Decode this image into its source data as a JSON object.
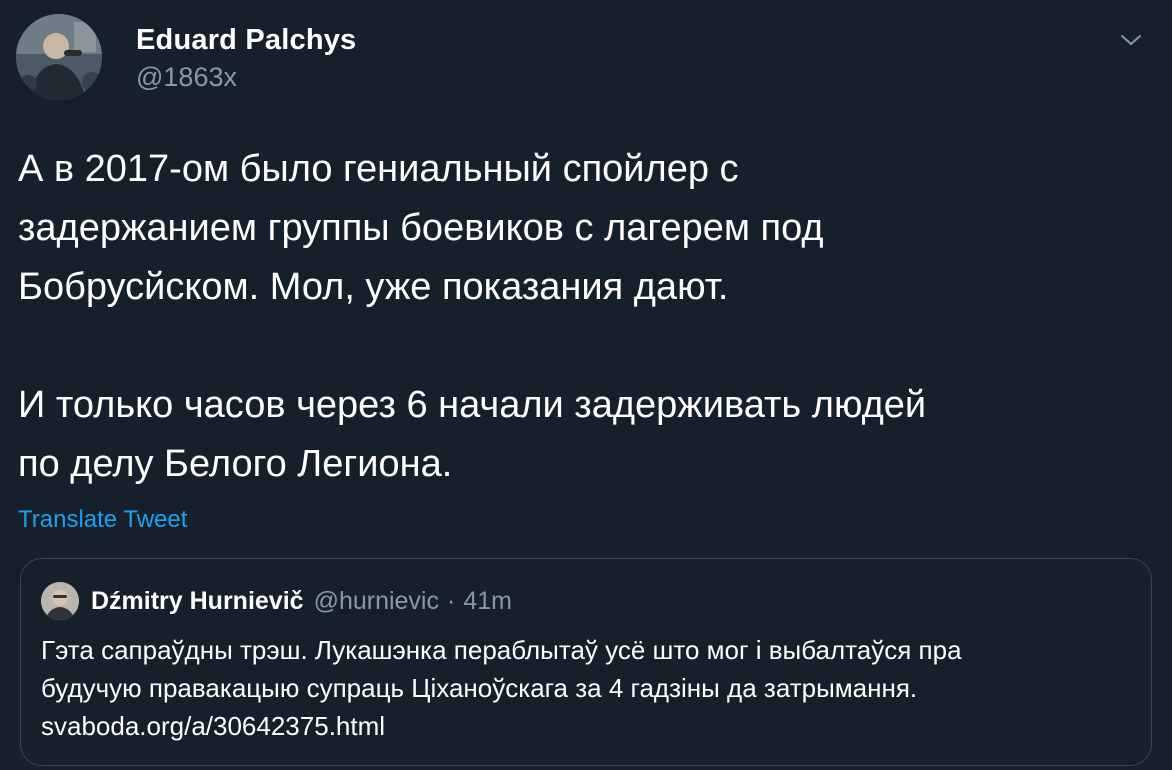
{
  "author": {
    "display_name": "Eduard Palchys",
    "handle": "@1863x"
  },
  "icons": {
    "menu": "chevron-down-icon",
    "avatar": "user-avatar"
  },
  "tweet": {
    "paragraphs": [
      "А в 2017-ом было гениальный спойлер с\nзадержанием группы боевиков с лагерем под\nБобрусйском. Мол, уже показания дают.",
      "И только часов через 6 начали задерживать людей\nпо делу Белого Легиона."
    ],
    "translate_label": "Translate Tweet"
  },
  "quoted_tweet": {
    "display_name": "Dźmitry Hurnievič",
    "handle": "@hurnievic",
    "separator": "·",
    "time": "41m",
    "lines": [
      "Гэта сапраўдны трэш. Лукашэнка пераблытаў усё што мог і выбалтаўся пра",
      "будучую правакацыю супраць Ціханоўскага за 4 гадзіны да затрымання.",
      "svaboda.org/a/30642375.html"
    ]
  },
  "colors": {
    "background": "#15202b",
    "text_primary": "#ffffff",
    "text_secondary": "#8899a6",
    "link": "#1da1f2",
    "border": "#38444d"
  }
}
